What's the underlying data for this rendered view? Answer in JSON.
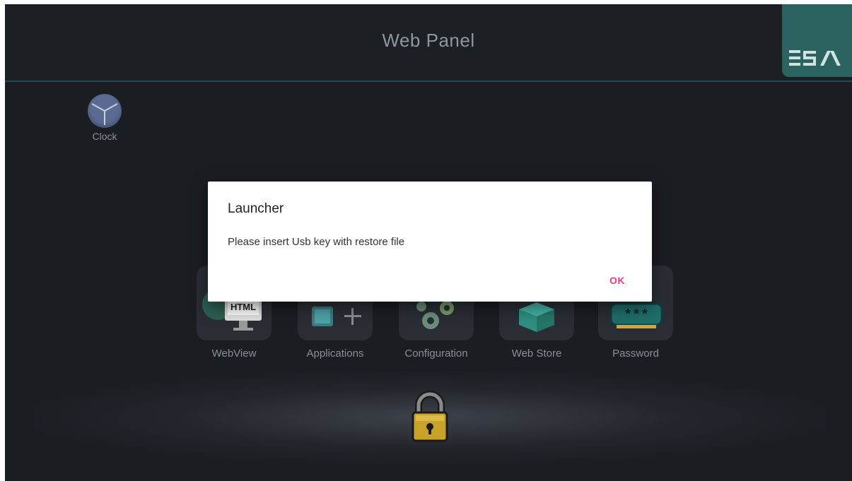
{
  "header": {
    "title": "Web Panel",
    "logo_icon": "esa-logo-icon"
  },
  "widgets": {
    "clock_label": "Clock"
  },
  "apps": [
    {
      "label": "WebView",
      "icon": "html-monitor-icon"
    },
    {
      "label": "Applications",
      "icon": "applications-icon"
    },
    {
      "label": "Configuration",
      "icon": "gears-icon"
    },
    {
      "label": "Web Store",
      "icon": "box-icon"
    },
    {
      "label": "Password",
      "icon": "password-field-icon"
    }
  ],
  "icons": {
    "html_badge": "HTML",
    "password_mask": "***"
  },
  "dialog": {
    "title": "Launcher",
    "message": "Please insert Usb key with restore file",
    "ok_label": "OK"
  },
  "colors": {
    "background": "#1a1d22",
    "header_border": "#1d4e57",
    "logo_tile": "#2a6360",
    "accent_ok": "#e8407c"
  }
}
